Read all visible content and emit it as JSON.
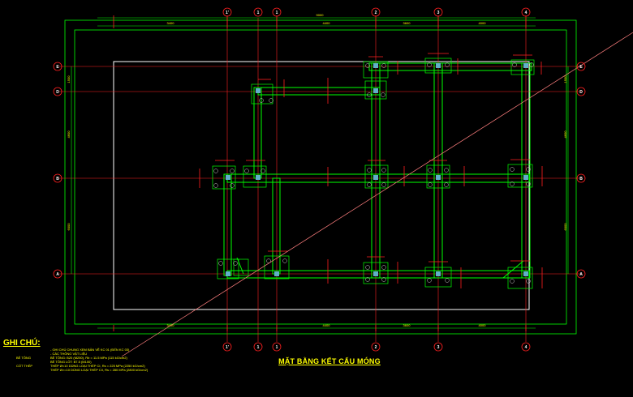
{
  "drawing": {
    "title": "MẶT BẰNG KẾT CẤU MÓNG",
    "colors": {
      "background": "#000000",
      "outer_frame": "#ffffff",
      "grid": "#ff2020",
      "foundation": "#00ff00",
      "dimension": "#00ff00",
      "column_fill": "#5fb0c8",
      "dim_text": "#ffff00",
      "note_text": "#ffff00",
      "diagonal": "#ff7f7f"
    },
    "axes_vertical": [
      "1'",
      "1",
      "1",
      "2",
      "3",
      "4"
    ],
    "axes_horizontal": [
      "E",
      "D",
      "B",
      "A"
    ],
    "top_dims_overall": "9000",
    "top_dims": [
      "3400",
      "4400",
      "3600",
      "4000"
    ],
    "bottom_dims": [
      "3400",
      "4400",
      "3600",
      "4000"
    ],
    "side_dims_left": [
      "1500",
      "4600",
      "6000"
    ],
    "side_dims_right": [
      "1500",
      "4600",
      "6000"
    ]
  },
  "notes": {
    "heading": "GHI CHÚ:",
    "lines": [
      {
        "k": "",
        "v": "- GHI CHÚ CHUNG XEM BẢN VẼ KC 01 (ĐẾN KC 03)"
      },
      {
        "k": "",
        "v": "- CÁC THÔNG VẬT LIỆU"
      },
      {
        "k": "BÊ TÔNG",
        "v": "BÊ TÔNG: B20 (M250), Rb = 11.5 MPa (115 kG/cm2)"
      },
      {
        "k": "",
        "v": "BÊ TÔNG LÓT: B7.5 (M100)"
      },
      {
        "k": "CỐT THÉP",
        "v": "THÉP Ø<10 DÙNG LOẠI THÉP CI, Rs = 225 MPa (2250 kG/cm2)"
      },
      {
        "k": "",
        "v": "THÉP Ø>=10 DÙNG LOẠI THÉP CII, Rs = 280 MPa (2800 kG/cm2)"
      }
    ]
  }
}
